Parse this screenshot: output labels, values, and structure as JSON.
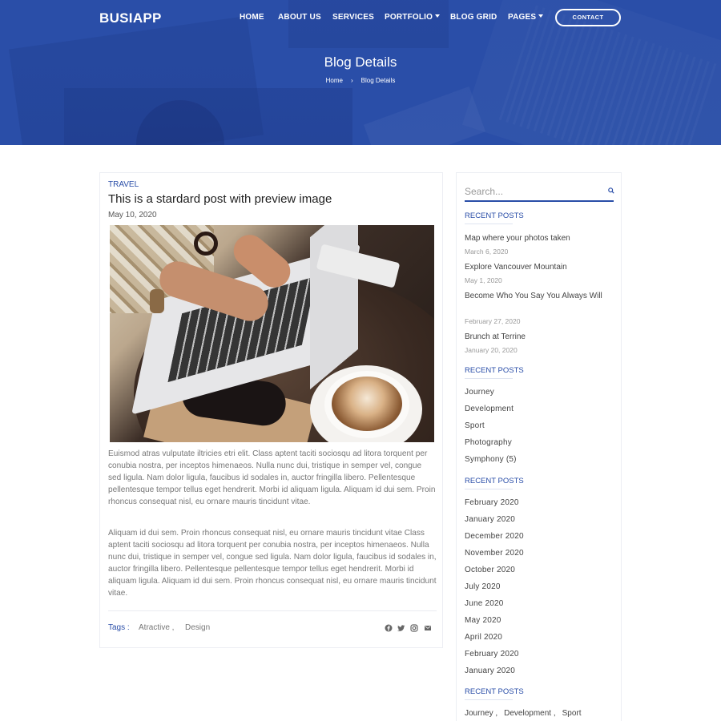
{
  "header": {
    "logo": "BUSIAPP",
    "nav": [
      {
        "label": "HOME",
        "dropdown": false
      },
      {
        "label": "ABOUT US",
        "dropdown": false
      },
      {
        "label": "SERVICES",
        "dropdown": false
      },
      {
        "label": "PORTFOLIO",
        "dropdown": true
      },
      {
        "label": "BLOG GRID",
        "dropdown": false
      },
      {
        "label": "PAGES",
        "dropdown": true
      }
    ],
    "contact_label": "CONTACT"
  },
  "hero": {
    "title": "Blog Details",
    "breadcrumb": [
      "Home",
      "Blog Details"
    ],
    "breadcrumb_separator": "›"
  },
  "post": {
    "category": "TRAVEL",
    "title": "This is a stardard post with preview image",
    "date": "May 10, 2020",
    "image_alt": "laptop-coffee-photo",
    "paragraphs": [
      "Euismod atras vulputate iltricies etri elit. Class aptent taciti sociosqu ad litora torquent per conubia nostra, per inceptos himenaeos. Nulla nunc dui, tristique in semper vel, congue sed ligula. Nam dolor ligula, faucibus id sodales in, auctor fringilla libero. Pellentesque pellentesque tempor tellus eget hendrerit. Morbi id aliquam ligula. Aliquam id dui sem. Proin rhoncus consequat nisl, eu ornare mauris tincidunt vitae.",
      "Aliquam id dui sem. Proin rhoncus consequat nisl, eu ornare mauris tincidunt vitae Class aptent taciti sociosqu ad litora torquent per conubia nostra, per inceptos himenaeos. Nulla nunc dui, tristique in semper vel, congue sed ligula. Nam dolor ligula, faucibus id sodales in, auctor fringilla libero. Pellentesque pellentesque tempor tellus eget hendrerit. Morbi id aliquam ligula. Aliquam id dui sem. Proin rhoncus consequat nisl, eu ornare mauris tincidunt vitae."
    ],
    "tags_label": "Tags :",
    "tags": [
      "Atractive ,",
      "Design"
    ],
    "share_icons": [
      "facebook-icon",
      "twitter-icon",
      "instagram-icon",
      "email-icon"
    ]
  },
  "sidebar": {
    "search_placeholder": "Search...",
    "recent_posts": {
      "title": "RECENT POSTS",
      "items": [
        {
          "title": "Map where your photos taken",
          "date": "March 6, 2020"
        },
        {
          "title": "Explore Vancouver Mountain",
          "date": "May 1, 2020"
        },
        {
          "title": "Become Who You Say You Always Will",
          "date": "February 27, 2020"
        },
        {
          "title": "Brunch at Terrine",
          "date": "January 20, 2020"
        }
      ]
    },
    "categories": {
      "title": "RECENT POSTS",
      "items": [
        "Journey",
        "Development",
        "Sport",
        "Photography",
        "Symphony (5)"
      ]
    },
    "archives": {
      "title": "RECENT POSTS",
      "items": [
        "February 2020",
        "January 2020",
        "December 2020",
        "November 2020",
        "October 2020",
        "July 2020",
        "June 2020",
        "May 2020",
        "April 2020",
        "February 2020",
        "January 2020"
      ]
    },
    "tags": {
      "title": "RECENT POSTS",
      "items": [
        "Journey",
        "Development",
        "Sport"
      ]
    }
  },
  "colors": {
    "brand": "#2a4ea8",
    "text": "#777777",
    "heading": "#222222"
  }
}
